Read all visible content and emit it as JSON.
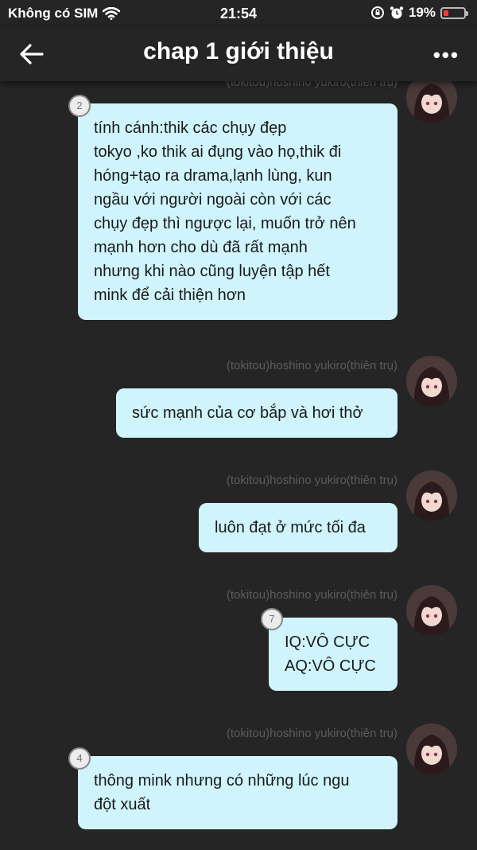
{
  "status_bar": {
    "carrier": "Không có SIM",
    "time": "21:54",
    "battery_percent": "19%"
  },
  "header": {
    "title": "chap 1 giới thiệu"
  },
  "messages": [
    {
      "sender": "(tokitou)hoshino yukiro(thiên trụ)",
      "badge": "2",
      "lines": [
        "tính cánh:thik các chụy đẹp",
        "tokyo ,ko thik ai đụng vào họ,thik đi",
        "hóng+tạo ra drama,lạnh lùng, kun",
        "ngầu với người ngoài còn với các",
        "chụy đẹp thì ngược lại, muốn trở nên",
        "mạnh hơn cho dù đã rất mạnh",
        "nhưng khi nào cũng luyện tập hết",
        "mink để cải thiện hơn"
      ]
    },
    {
      "sender": "(tokitou)hoshino yukiro(thiên trụ)",
      "lines": [
        "sức mạnh của cơ bắp và hơi thở"
      ]
    },
    {
      "sender": "(tokitou)hoshino yukiro(thiên trụ)",
      "lines": [
        "luôn đạt ở mức tối đa"
      ]
    },
    {
      "sender": "(tokitou)hoshino yukiro(thiên trụ)",
      "badge": "7",
      "lines": [
        "IQ:VÔ CỰC",
        "AQ:VÔ CỰC"
      ]
    },
    {
      "sender": "(tokitou)hoshino yukiro(thiên trụ)",
      "badge": "4",
      "lines": [
        "thông mink nhưng có những lúc ngu",
        "đột xuất"
      ]
    }
  ]
}
